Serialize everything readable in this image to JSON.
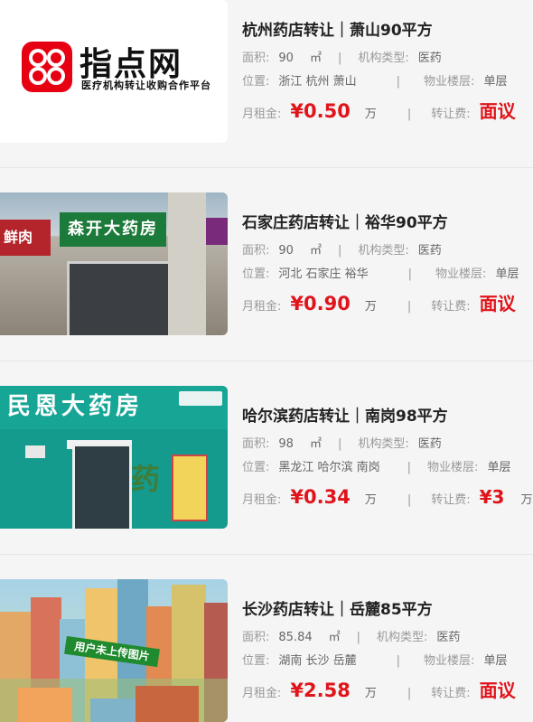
{
  "listings": [
    {
      "title": "杭州药店转让｜萧山90平方",
      "area_label": "面积:",
      "area_value": "90",
      "area_unit": "㎡",
      "type_label": "机构类型:",
      "type_value": "医药",
      "location_label": "位置:",
      "location_value": "浙江 杭州 萧山",
      "floor_label": "物业楼层:",
      "floor_value": "单层",
      "rent_label": "月租金:",
      "rent_value": "¥0.50",
      "rent_unit": "万",
      "fee_label": "转让费:",
      "fee_value": "面议",
      "fee_unit": "",
      "image": "logo",
      "logo_text": "指点网",
      "logo_sub": "医疗机构转让收购合作平台"
    },
    {
      "title": "石家庄药店转让｜裕华90平方",
      "area_label": "面积:",
      "area_value": "90",
      "area_unit": "㎡",
      "type_label": "机构类型:",
      "type_value": "医药",
      "location_label": "位置:",
      "location_value": "河北 石家庄 裕华",
      "floor_label": "物业楼层:",
      "floor_value": "单层",
      "rent_label": "月租金:",
      "rent_value": "¥0.90",
      "rent_unit": "万",
      "fee_label": "转让费:",
      "fee_value": "面议",
      "fee_unit": "",
      "image": "photo",
      "sign_text": "森开大药房",
      "side_sign": "鲜肉"
    },
    {
      "title": "哈尔滨药店转让｜南岗98平方",
      "area_label": "面积:",
      "area_value": "98",
      "area_unit": "㎡",
      "type_label": "机构类型:",
      "type_value": "医药",
      "location_label": "位置:",
      "location_value": "黑龙江 哈尔滨 南岗",
      "floor_label": "物业楼层:",
      "floor_value": "单层",
      "rent_label": "月租金:",
      "rent_value": "¥0.34",
      "rent_unit": "万",
      "fee_label": "转让费:",
      "fee_value": "¥3",
      "fee_unit": "万",
      "image": "photo",
      "sign_text": "民恩大药房",
      "door_text": "药"
    },
    {
      "title": "长沙药店转让｜岳麓85平方",
      "area_label": "面积:",
      "area_value": "85.84",
      "area_unit": "㎡",
      "type_label": "机构类型:",
      "type_value": "医药",
      "location_label": "位置:",
      "location_value": "湖南 长沙 岳麓",
      "floor_label": "物业楼层:",
      "floor_value": "单层",
      "rent_label": "月租金:",
      "rent_value": "¥2.58",
      "rent_unit": "万",
      "fee_label": "转让费:",
      "fee_value": "面议",
      "fee_unit": "",
      "image": "illustration",
      "banner_text": "用户未上传图片"
    }
  ],
  "colors": {
    "accent": "#e0141b",
    "logo_red": "#e60012",
    "background": "#f5f5f5"
  }
}
